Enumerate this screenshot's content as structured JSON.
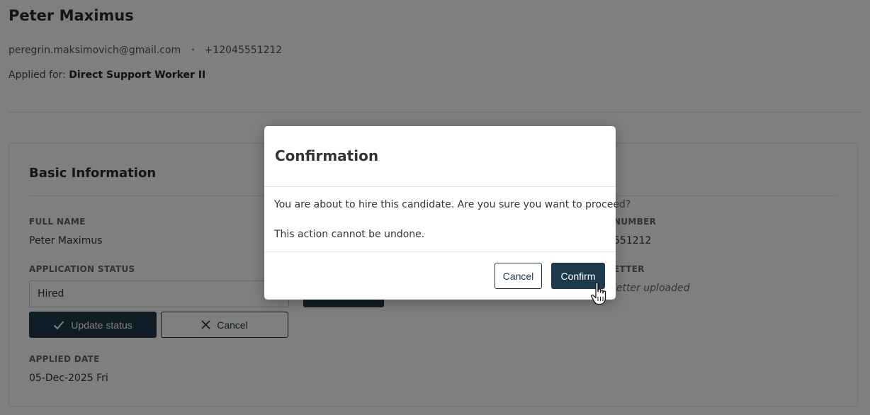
{
  "candidate": {
    "name": "Peter Maximus",
    "email": "peregrin.maksimovich@gmail.com",
    "contact_separator": "•",
    "phone": "+12045551212",
    "applied_for_label": "Applied for:",
    "applied_for_value": "Direct Support Worker II"
  },
  "basic_info": {
    "title": "Basic Information",
    "full_name_label": "FULL NAME",
    "full_name_value": "Peter Maximus",
    "application_status_label": "APPLICATION STATUS",
    "application_status_value": "Hired",
    "update_status_label": "Update status",
    "cancel_label": "Cancel",
    "applied_date_label": "APPLIED DATE",
    "applied_date_value": "05-Dec-2025 Fri",
    "phone_label_partial": "NUMBER",
    "phone_value_partial": "551212",
    "letter_label_partial": "ETTER",
    "letter_value_partial": "letter uploaded"
  },
  "modal": {
    "title": "Confirmation",
    "message": "You are about to hire this candidate. Are you sure you want to proceed?",
    "warning": "This action cannot be undone.",
    "cancel_label": "Cancel",
    "confirm_label": "Confirm"
  },
  "colors": {
    "primary": "#1c3a4c",
    "overlay": "rgba(0,0,0,0.5)"
  },
  "icons": {
    "update_icon": "check-icon",
    "cancel_icon": "close-icon",
    "cursor_icon": "hand-pointer-icon"
  }
}
